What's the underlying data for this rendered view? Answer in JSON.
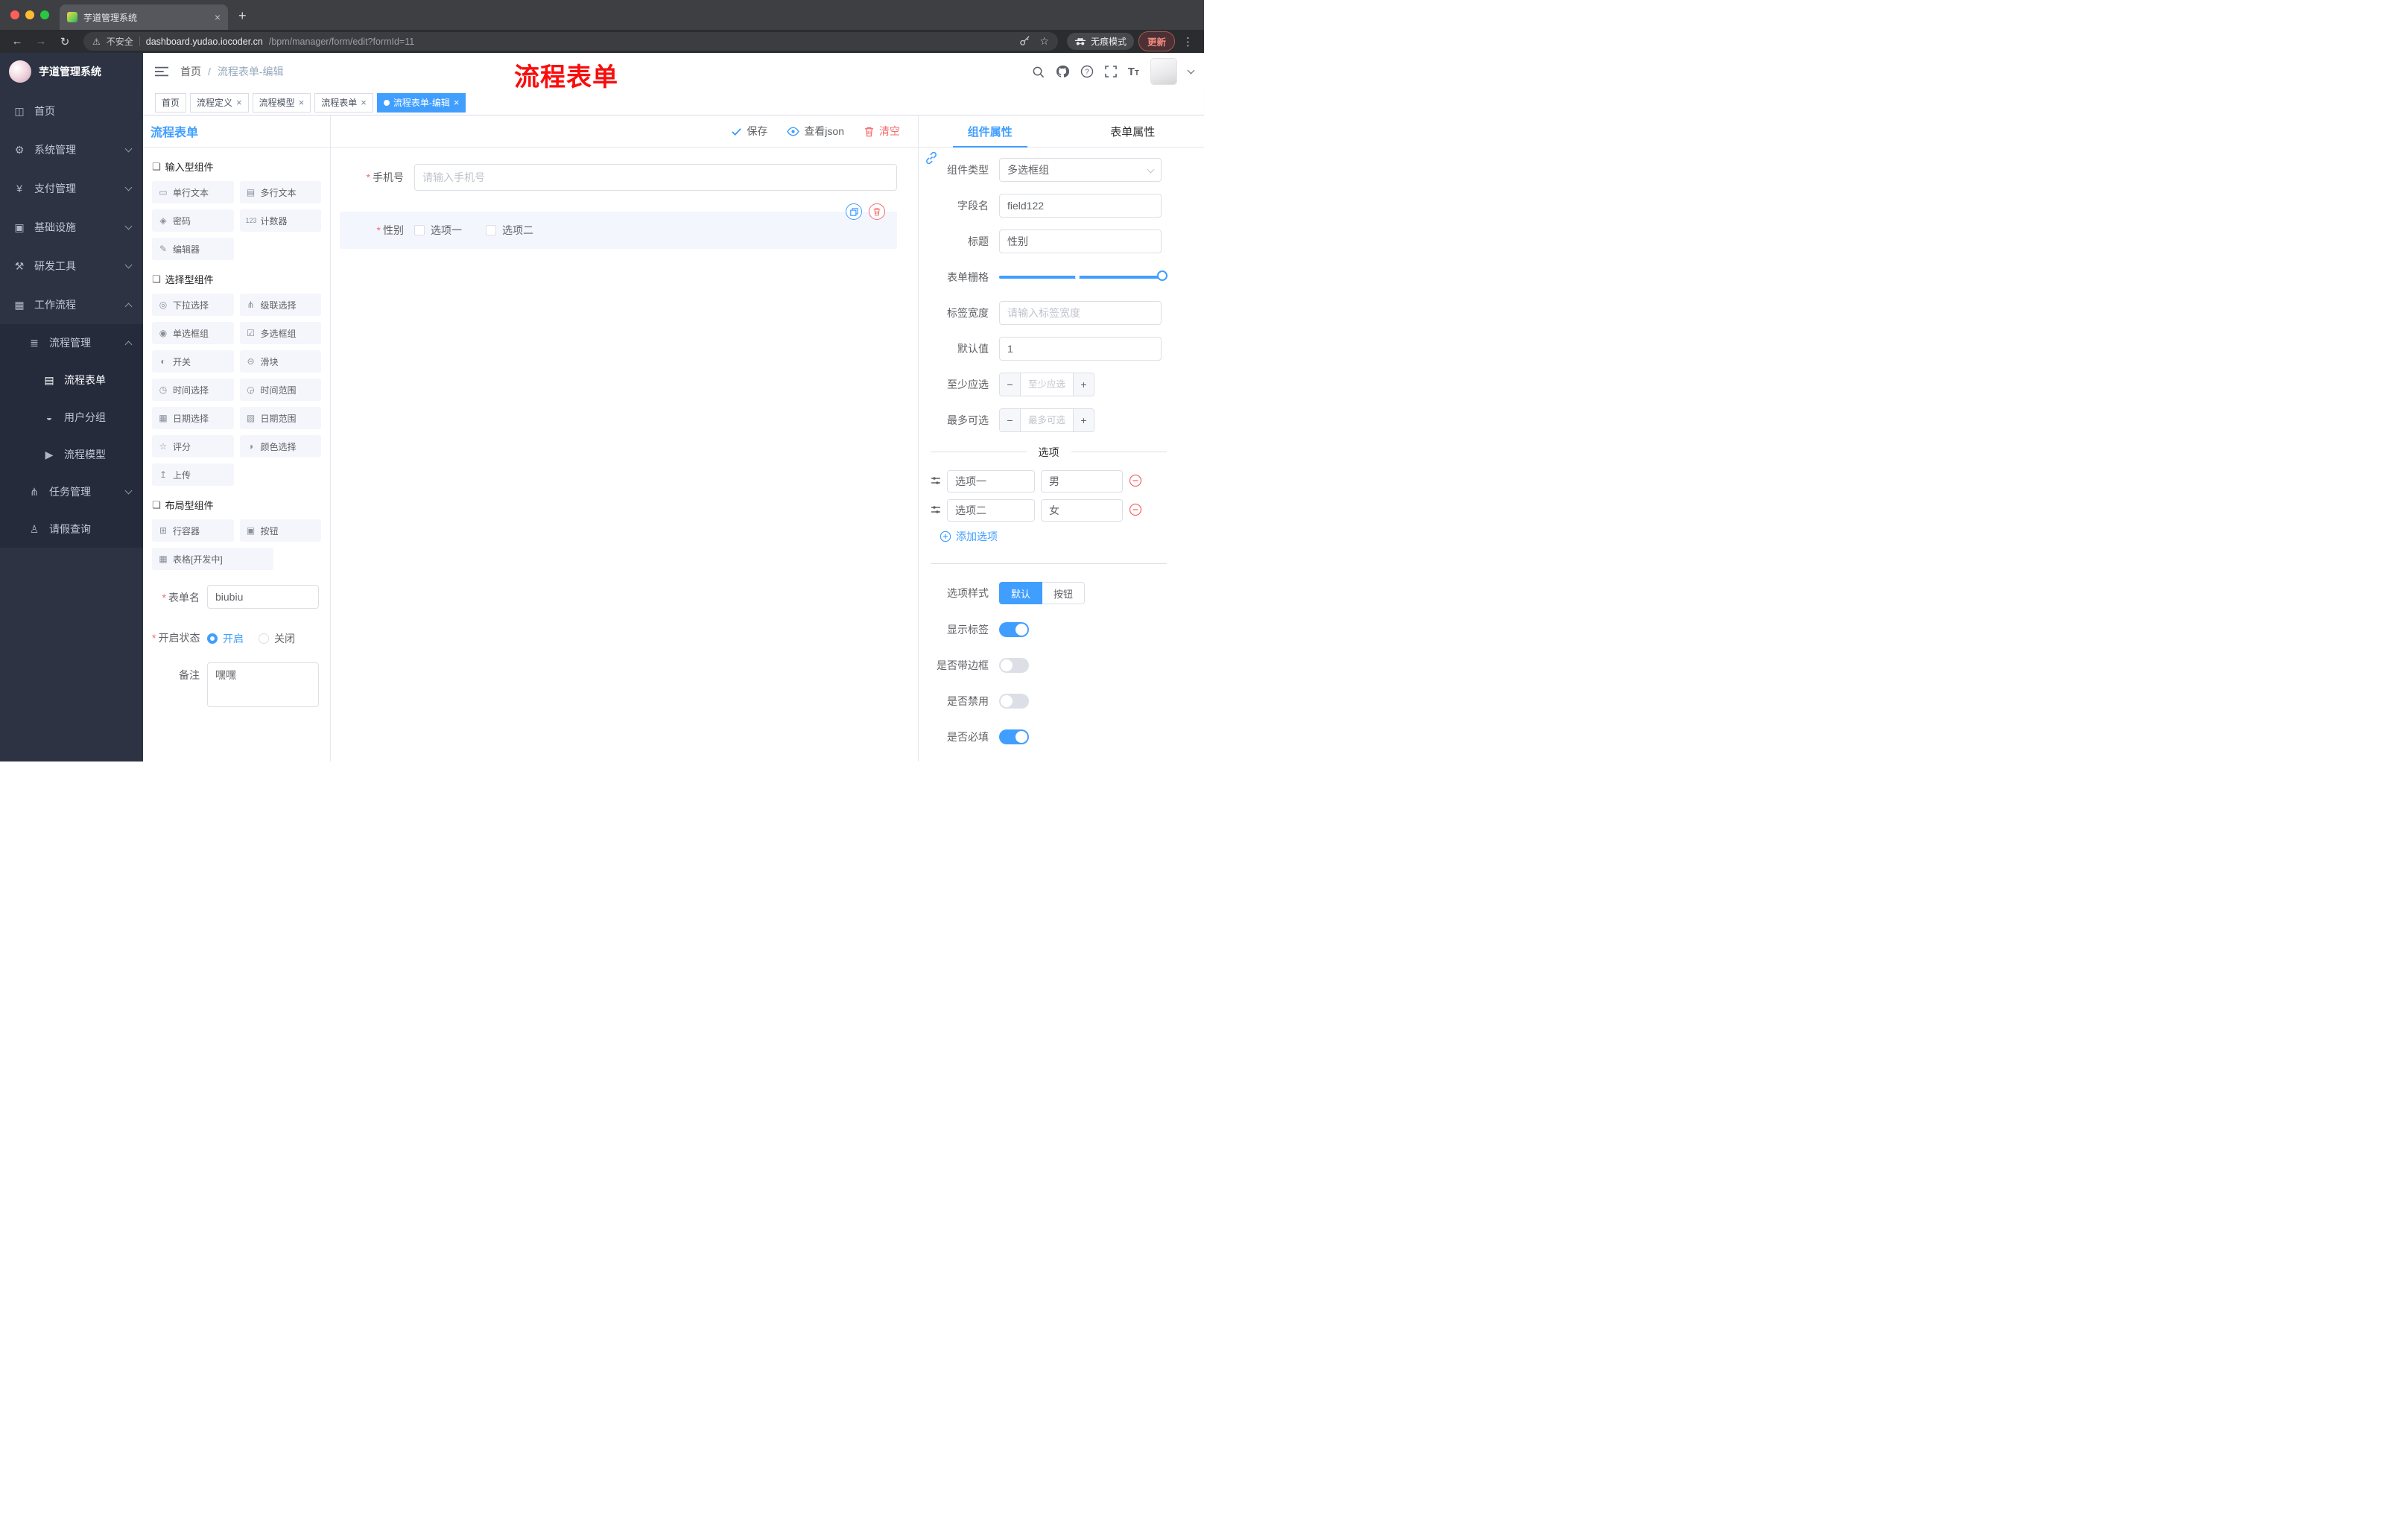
{
  "colors": {
    "accent": "#409eff",
    "danger": "#f56c6c",
    "annotation_red": "#fa0d0d",
    "sidebar_bg": "#2d3343"
  },
  "browser": {
    "tab_title": "芋道管理系统",
    "security_label": "不安全",
    "url_host": "dashboard.yudao.iocoder.cn",
    "url_path": "/bpm/manager/form/edit?formId=11",
    "incognito_label": "无痕模式",
    "update_label": "更新"
  },
  "sidebar": {
    "logo_title": "芋道管理系统",
    "items": [
      {
        "label": "首页"
      },
      {
        "label": "系统管理"
      },
      {
        "label": "支付管理"
      },
      {
        "label": "基础设施"
      },
      {
        "label": "研发工具"
      },
      {
        "label": "工作流程"
      },
      {
        "label": "流程管理"
      },
      {
        "label": "流程表单"
      },
      {
        "label": "用户分组"
      },
      {
        "label": "流程模型"
      },
      {
        "label": "任务管理"
      },
      {
        "label": "请假查询"
      }
    ]
  },
  "navbar": {
    "breadcrumb_home": "首页",
    "breadcrumb_separator": "/",
    "breadcrumb_current": "流程表单-编辑",
    "annotation": "流程表单"
  },
  "tags": [
    {
      "label": "首页"
    },
    {
      "label": "流程定义"
    },
    {
      "label": "流程模型"
    },
    {
      "label": "流程表单"
    },
    {
      "label": "流程表单-编辑"
    }
  ],
  "designer": {
    "panel_title": "流程表单",
    "actions": {
      "save": "保存",
      "view_json": "查看json",
      "clear": "清空"
    },
    "palette": {
      "groups": [
        {
          "title": "输入型组件",
          "items": [
            {
              "label": "单行文本"
            },
            {
              "label": "多行文本"
            },
            {
              "label": "密码"
            },
            {
              "label": "计数器"
            },
            {
              "label": "编辑器"
            }
          ]
        },
        {
          "title": "选择型组件",
          "items": [
            {
              "label": "下拉选择"
            },
            {
              "label": "级联选择"
            },
            {
              "label": "单选框组"
            },
            {
              "label": "多选框组"
            },
            {
              "label": "开关"
            },
            {
              "label": "滑块"
            },
            {
              "label": "时间选择"
            },
            {
              "label": "时间范围"
            },
            {
              "label": "日期选择"
            },
            {
              "label": "日期范围"
            },
            {
              "label": "评分"
            },
            {
              "label": "颜色选择"
            },
            {
              "label": "上传"
            }
          ]
        },
        {
          "title": "布局型组件",
          "items": [
            {
              "label": "行容器"
            },
            {
              "label": "按钮"
            },
            {
              "label": "表格[开发中]"
            }
          ]
        }
      ]
    },
    "meta": {
      "form_name_label": "表单名",
      "form_name_value": "biubiu",
      "status_label": "开启状态",
      "status_on": "开启",
      "status_off": "关闭",
      "remark_label": "备注",
      "remark_value": "嘿嘿"
    },
    "canvas": {
      "phone_label": "手机号",
      "phone_placeholder": "请输入手机号",
      "gender_label": "性别",
      "gender_options": [
        {
          "label": "选项一"
        },
        {
          "label": "选项二"
        }
      ]
    }
  },
  "props": {
    "tab_component": "组件属性",
    "tab_form": "表单属性",
    "rows": {
      "component_type": {
        "label": "组件类型",
        "value": "多选框组"
      },
      "field_name": {
        "label": "字段名",
        "value": "field122"
      },
      "title": {
        "label": "标题",
        "value": "性别"
      },
      "grid": {
        "label": "表单栅格"
      },
      "label_width": {
        "label": "标签宽度",
        "placeholder": "请输入标签宽度"
      },
      "default_value": {
        "label": "默认值",
        "value": "1"
      },
      "min_select": {
        "label": "至少应选",
        "placeholder": "至少应选"
      },
      "max_select": {
        "label": "最多可选",
        "placeholder": "最多可选"
      }
    },
    "options_title": "选项",
    "options": [
      {
        "label": "选项一",
        "value": "男"
      },
      {
        "label": "选项二",
        "value": "女"
      }
    ],
    "add_option_label": "添加选项",
    "style_label": "选项样式",
    "style_default": "默认",
    "style_button": "按钮",
    "switches": [
      {
        "label": "显示标签",
        "on": true
      },
      {
        "label": "是否带边框",
        "on": false
      },
      {
        "label": "是否禁用",
        "on": false
      },
      {
        "label": "是否必填",
        "on": true
      }
    ]
  }
}
